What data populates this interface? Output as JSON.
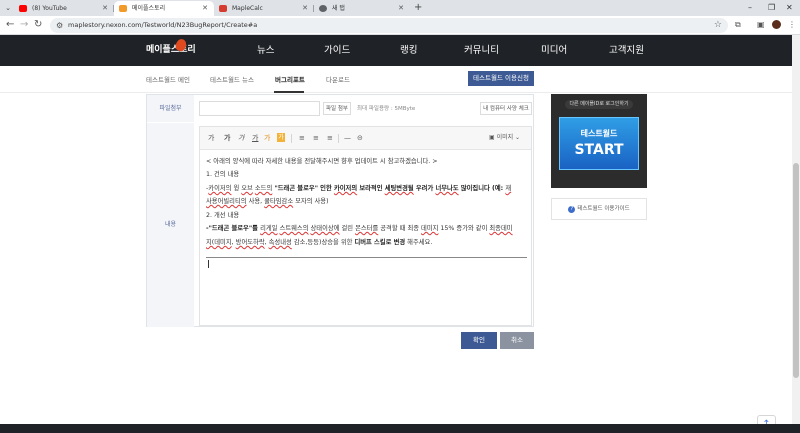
{
  "browser": {
    "tabs": [
      {
        "title": "(8) YouTube",
        "favicon_color": "#ff0000"
      },
      {
        "title": "메이플스토리",
        "favicon_color": "#f29b2b"
      },
      {
        "title": "MapleCalc",
        "favicon_color": "#d63b2f"
      },
      {
        "title": "새 탭",
        "favicon_color": "#5f6368"
      }
    ],
    "new_tab": "+",
    "menu_glyph": "⌄",
    "url": "maplestory.nexon.com/Testworld/N23BugReport/Create#a",
    "window_controls": [
      "–",
      "❐",
      "✕"
    ]
  },
  "site": {
    "logo": "메이플스토리",
    "menu": [
      "뉴스",
      "가이드",
      "랭킹",
      "커뮤니티",
      "미디어",
      "고객지원"
    ],
    "subnav": [
      "테스트월드 메인",
      "테스트월드 뉴스",
      "버그리포트",
      "다운로드"
    ],
    "subnav_active": "버그리포트",
    "apply_button": "테스트월드 이용신청"
  },
  "form": {
    "file_label": "파일첨부",
    "file_button": "파일 첨부",
    "file_info": "최대 파일용량 : 5MByte",
    "file_check": "내 컴퓨터 사양 체크",
    "content_label": "내용",
    "toolbar": {
      "font_size": "가",
      "bold": "가",
      "italic": "가",
      "underline": "가",
      "color": "가",
      "highlight": "가",
      "align_left": "≡",
      "align_center": "≡",
      "align_right": "≡",
      "hr": "—",
      "link": "⊝",
      "image": "이미지"
    },
    "body": {
      "l1": "< 아래의 양식에 따라 자세한 내용을 전달해주시면 향후 업데이트 시 참고하겠습니다. >",
      "l2": "1. 건의 내용",
      "l3a": "-",
      "l3b": "카이저의",
      "l3c": " 윙 ",
      "l3d": "오브",
      "l3e": " ",
      "l3f": "소드의",
      "l3g": " \"드래곤 블로우\" 인한 ",
      "l3h": "카이저의",
      "l3i": " 보라적인 ",
      "l3j": "세팅변경될",
      "l3k": " 우려가 ",
      "l3l": "너무나도",
      "l3m": " 많이집니다 (예: ",
      "l3n": "재",
      "l4a": "사용어빌리티의",
      "l4b": " 사용, ",
      "l4c": "쿨타임감소",
      "l4d": " 모자의 사용)",
      "l5": "2. 개선 내용",
      "l6a": "-\"드래곤 블로우\"를 ",
      "l6b": "리게일",
      "l6c": " ",
      "l6d": "스트웨스의",
      "l6e": " ",
      "l6f": "상태이상에",
      "l6g": " 걸린 ",
      "l6h": "몬스터를",
      "l6i": " 공격할 때 최종 ",
      "l6j": "데미지",
      "l6k": " 15% 증가와 같이 ",
      "l6l": "최종데미",
      "l7a": "지(데미지",
      "l7b": ", ",
      "l7c": "방어도하락",
      "l7d": ", ",
      "l7e": "속성내성",
      "l7f": " 감소,등등)상승을 위한 ",
      "l7g": "디버프 스킬로 변경",
      "l7h": " 해주세요."
    },
    "ok_button": "확인",
    "cancel_button": "취소"
  },
  "side": {
    "banner_top": "다른 메이플ID로 로그인하기",
    "start_title": "테스트월드",
    "start_label": "START",
    "guide_icon": "?",
    "guide": "테스트월드 이용가이드"
  },
  "top_button": "↑"
}
